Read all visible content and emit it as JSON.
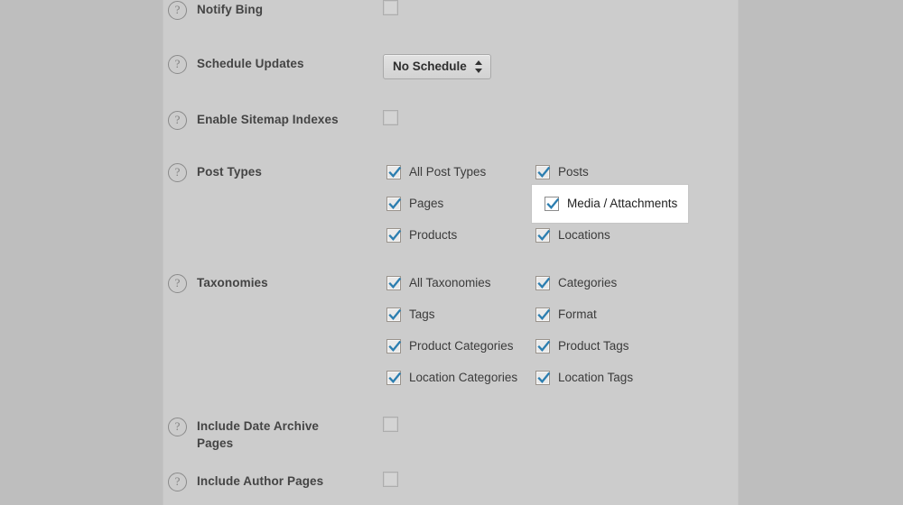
{
  "panel": {
    "rows": [
      {
        "id": "notify-bing",
        "label": "Notify Bing",
        "help_icon": "question-mark-circle-icon",
        "control": "checkbox-plain",
        "checked": false
      },
      {
        "id": "schedule-updates",
        "label": "Schedule Updates",
        "help_icon": "question-mark-circle-icon",
        "control": "select",
        "selected_value": "No Schedule",
        "stepper_icon": "up-down-stepper-icon"
      },
      {
        "id": "enable-sitemap-indexes",
        "label": "Enable Sitemap Indexes",
        "help_icon": "question-mark-circle-icon",
        "control": "checkbox-plain",
        "checked": false
      },
      {
        "id": "post-types",
        "label": "Post Types",
        "help_icon": "question-mark-circle-icon",
        "control": "checkbox-grid",
        "options": [
          {
            "label": "All Post Types",
            "checked": true,
            "col": 0,
            "row": 0,
            "highlighted": false
          },
          {
            "label": "Posts",
            "checked": true,
            "col": 1,
            "row": 0,
            "highlighted": false
          },
          {
            "label": "Pages",
            "checked": true,
            "col": 0,
            "row": 1,
            "highlighted": false
          },
          {
            "label": "Media / Attachments",
            "checked": true,
            "col": 1,
            "row": 1,
            "highlighted": true
          },
          {
            "label": "Products",
            "checked": true,
            "col": 0,
            "row": 2,
            "highlighted": false
          },
          {
            "label": "Locations",
            "checked": true,
            "col": 1,
            "row": 2,
            "highlighted": false
          }
        ]
      },
      {
        "id": "taxonomies",
        "label": "Taxonomies",
        "help_icon": "question-mark-circle-icon",
        "control": "checkbox-grid",
        "options": [
          {
            "label": "All Taxonomies",
            "checked": true,
            "col": 0,
            "row": 0,
            "highlighted": false
          },
          {
            "label": "Categories",
            "checked": true,
            "col": 1,
            "row": 0,
            "highlighted": false
          },
          {
            "label": "Tags",
            "checked": true,
            "col": 0,
            "row": 1,
            "highlighted": false
          },
          {
            "label": "Format",
            "checked": true,
            "col": 1,
            "row": 1,
            "highlighted": false
          },
          {
            "label": "Product Categories",
            "checked": true,
            "col": 0,
            "row": 2,
            "highlighted": false
          },
          {
            "label": "Product Tags",
            "checked": true,
            "col": 1,
            "row": 2,
            "highlighted": false
          },
          {
            "label": "Location Categories",
            "checked": true,
            "col": 0,
            "row": 3,
            "highlighted": false
          },
          {
            "label": "Location Tags",
            "checked": true,
            "col": 1,
            "row": 3,
            "highlighted": false
          }
        ]
      },
      {
        "id": "include-date-archive-pages",
        "label": "Include Date Archive Pages",
        "help_icon": "question-mark-circle-icon",
        "control": "checkbox-plain",
        "checked": false
      },
      {
        "id": "include-author-pages",
        "label": "Include Author Pages",
        "help_icon": "question-mark-circle-icon",
        "control": "checkbox-plain",
        "checked": false
      }
    ],
    "help_glyph": "?"
  },
  "colors": {
    "page_background": "#bebebe",
    "panel_background": "#cccccc",
    "checkmark": "#2c7eb0",
    "label_text": "#444444",
    "highlight_background": "#ffffff"
  },
  "layout": {
    "row_tops": [
      0,
      60,
      122,
      180,
      303,
      462,
      523
    ],
    "grid_col_x": [
      0,
      165
    ],
    "grid_row_h": 35
  }
}
